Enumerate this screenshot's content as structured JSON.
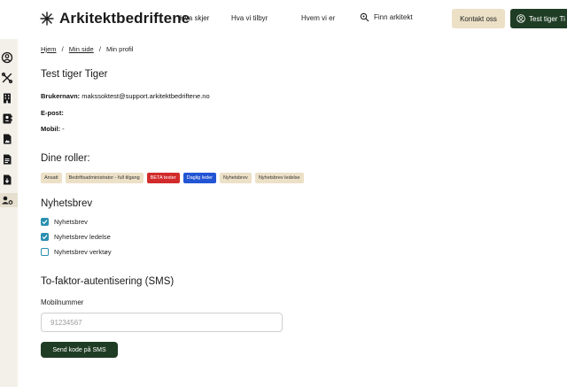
{
  "header": {
    "logo_text": "Arkitektbedriftene",
    "nav": [
      "Hva skjer",
      "Hva vi tilbyr",
      "Hvem vi er"
    ],
    "finn_arkitekt": "Finn arkitekt",
    "kontakt": "Kontakt oss",
    "user_button": "Test tiger Ti"
  },
  "breadcrumb": {
    "home": "Hjem",
    "sep1": "/",
    "minside": "Min side",
    "sep2": "/",
    "current": "Min profil"
  },
  "profile": {
    "name": "Test tiger Tiger",
    "username_label": "Brukernavn:",
    "username_value": " makssoktest@support.arkitektbedriftene.no",
    "email_label": "E-post:",
    "email_value": "",
    "mobile_label": "Mobil:",
    "mobile_value": " -"
  },
  "roles": {
    "heading": "Dine roller:",
    "items": [
      "Ansatt",
      "Bedriftsadministrator - full tilgang",
      "BETA tester",
      "Daglig leder",
      "Nyhetsbrev",
      "Nyhetsbrev ledelse"
    ]
  },
  "newsletter": {
    "heading": "Nyhetsbrev",
    "items": [
      {
        "label": "Nyhetsbrev",
        "checked": true
      },
      {
        "label": "Nyhetsbrev ledelse",
        "checked": true
      },
      {
        "label": "Nyhetsbrev verktøy",
        "checked": false
      }
    ]
  },
  "twofactor": {
    "heading": "To-faktor-autentisering (SMS)",
    "mobile_label": "Mobilnummer",
    "placeholder": "91234567",
    "send_button": "Send kode på SMS"
  },
  "colors": {
    "brand_green": "#1f3d24",
    "sand": "#ece0c6",
    "check_blue": "#2a8fb0",
    "beta_red": "#d22b2b",
    "leader_blue": "#2255d4"
  }
}
